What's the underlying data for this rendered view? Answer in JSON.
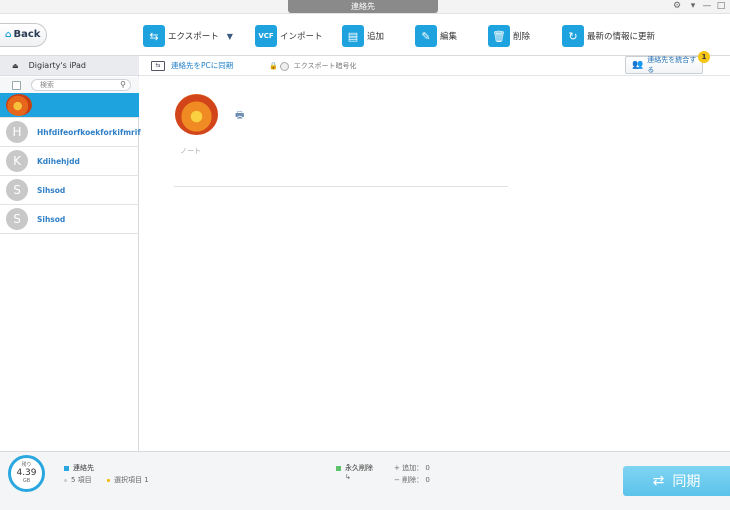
{
  "window": {
    "title": "連絡先",
    "settings_icon": "gear-icon",
    "minimize": "—",
    "maximize": "□"
  },
  "toolbar": {
    "back_label": "Back",
    "export_label": "エクスポート",
    "import_label": "インポート",
    "add_label": "追加",
    "edit_label": "編集",
    "delete_label": "削除",
    "refresh_label": "最新の情報に更新"
  },
  "sidebar": {
    "device_name": "Digiarty's iPad",
    "search_placeholder": "検索",
    "contacts": [
      {
        "initial": "",
        "name": ""
      },
      {
        "initial": "H",
        "name": "Hhfdifeorfkoekforkifmrif"
      },
      {
        "initial": "K",
        "name": "Kdihehjdd"
      },
      {
        "initial": "S",
        "name": "Sihsod"
      },
      {
        "initial": "S",
        "name": "Sihsod"
      }
    ]
  },
  "topbar": {
    "sync_to_pc": "連絡先をPCに同期",
    "encrypt_export": "エクスポート暗号化",
    "merge_label": "連絡先を統合する",
    "merge_badge": "1"
  },
  "detail": {
    "note_label": "ノート"
  },
  "footer": {
    "storage_label": "残り",
    "storage_value": "4.39",
    "storage_unit": "GB",
    "contacts_label": "連絡先",
    "items_count": "5 項目",
    "selected_count": "選択項目 1",
    "permanent_delete": "永久削除",
    "add_label": "追加：",
    "add_count": "0",
    "delete_label": "削除：",
    "delete_count": "0",
    "sync_label": "同期"
  },
  "colors": {
    "accent": "#1fa3de",
    "contacts_legend": "#2aa7df",
    "delete_legend": "#5cc36a",
    "selected_dot": "#f5b400"
  }
}
